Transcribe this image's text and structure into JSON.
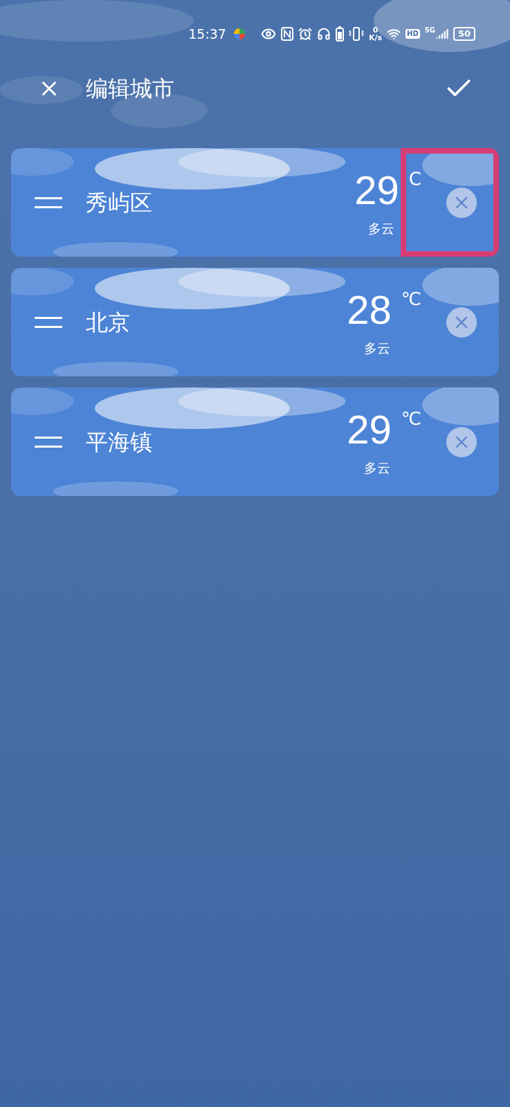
{
  "status_bar": {
    "time": "15:37",
    "net_speed_value": "0",
    "net_speed_unit": "K/s",
    "hd_badge": "HD",
    "network_type": "5G",
    "battery": "50"
  },
  "header": {
    "title": "编辑城市"
  },
  "cities": [
    {
      "name": "秀屿区",
      "temperature": "29",
      "unit": "C",
      "condition": "多云",
      "highlighted": true
    },
    {
      "name": "北京",
      "temperature": "28",
      "unit": "℃",
      "condition": "多云",
      "highlighted": false
    },
    {
      "name": "平海镇",
      "temperature": "29",
      "unit": "℃",
      "condition": "多云",
      "highlighted": false
    }
  ]
}
